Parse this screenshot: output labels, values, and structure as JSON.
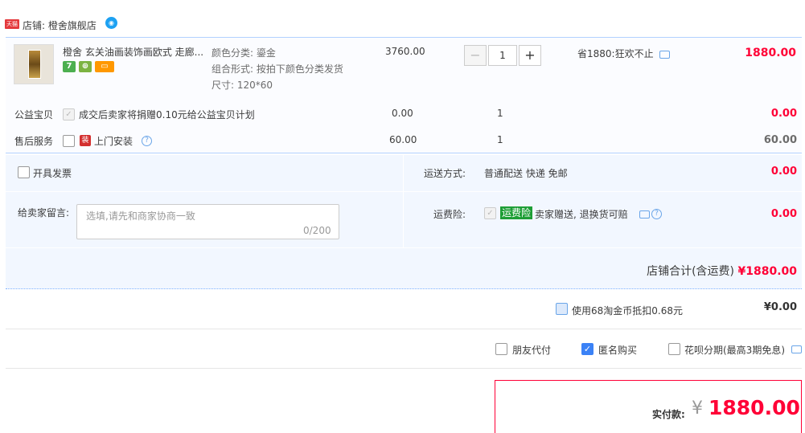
{
  "shop": {
    "badge": "天猫",
    "label": "店铺: 橙舍旗舰店",
    "ww_icon": "chat-bubble-icon",
    "ww_text": "◉"
  },
  "item": {
    "title": "橙舍 玄关油画装饰画欧式 走廊...",
    "badges": [
      "7",
      "⊕",
      "▭"
    ],
    "props": [
      "颜色分类: 鎏金",
      "组合形式: 按拍下颜色分类发货",
      "尺寸: 120*60"
    ],
    "price": "3760.00",
    "qty_minus": "−",
    "qty": "1",
    "qty_plus": "+",
    "promo": "省1880:狂欢不止",
    "subtotal": "1880.00"
  },
  "charity": {
    "label": "公益宝贝",
    "check": "✓",
    "text": "成交后卖家将捐赠0.10元给公益宝贝计划",
    "price": "0.00",
    "qty": "1",
    "amount": "0.00"
  },
  "service": {
    "label": "售后服务",
    "icon_text": "装",
    "text": "上门安装",
    "help": "?",
    "price": "60.00",
    "qty": "1",
    "amount": "60.00"
  },
  "invoice": {
    "label": "开具发票"
  },
  "shipping": {
    "label": "运送方式:",
    "value": "普通配送 快递 免邮",
    "amount": "0.00"
  },
  "memo": {
    "label": "给卖家留言:",
    "placeholder": "选填,请先和商家协商一致",
    "count": "0/200"
  },
  "insurance": {
    "label": "运费险:",
    "check": "✓",
    "tag": "运费险",
    "text": "卖家赠送, 退换货可赔",
    "help": "?",
    "amount": "0.00"
  },
  "shop_total": {
    "label": "店铺合计(含运费)",
    "amount": "¥1880.00"
  },
  "coins": {
    "label": "使用68淘金币抵扣0.68元",
    "amount": "¥0.00"
  },
  "options": {
    "friend_pay": "朋友代付",
    "anonymous": "匿名购买",
    "anon_check": "✓",
    "huabei": "花呗分期(最高3期免息)"
  },
  "payment": {
    "label": "实付款:",
    "yen": "¥",
    "amount": "1880.00"
  }
}
